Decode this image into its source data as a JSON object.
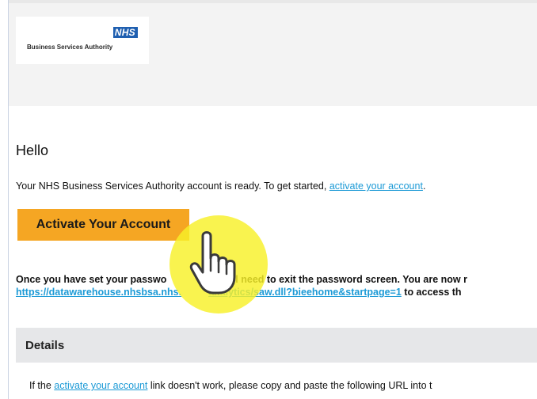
{
  "header": {
    "logo_mark": "NHS",
    "org_name": "Business Services Authority"
  },
  "email": {
    "greeting": "Hello",
    "intro_text": "Your NHS Business Services Authority account is ready. To get started, ",
    "intro_link": "activate your account",
    "intro_end": ".",
    "activate_button_label": "Activate Your Account",
    "info_line1_a": "Once you have set your passwo",
    "info_line1_b": "ill need to exit the password screen.  You are now r",
    "info_url": "https://datawarehouse.nhsbsa.nhs.",
    "info_url_b": "analytics/saw.dll?bieehome&startpage=1",
    "info_line2_rest": " to access th",
    "details_title": "Details",
    "fallback_pre": "If the ",
    "fallback_link": "activate your account",
    "fallback_post": " link doesn't work, please copy and paste the following URL into t"
  },
  "colors": {
    "accent_button": "#f5a623",
    "link": "#1c9ad6",
    "nhs_blue": "#1f5fb0",
    "cursor_highlight": "#f8f028"
  },
  "icons": {
    "cursor": "hand-pointer-icon"
  }
}
